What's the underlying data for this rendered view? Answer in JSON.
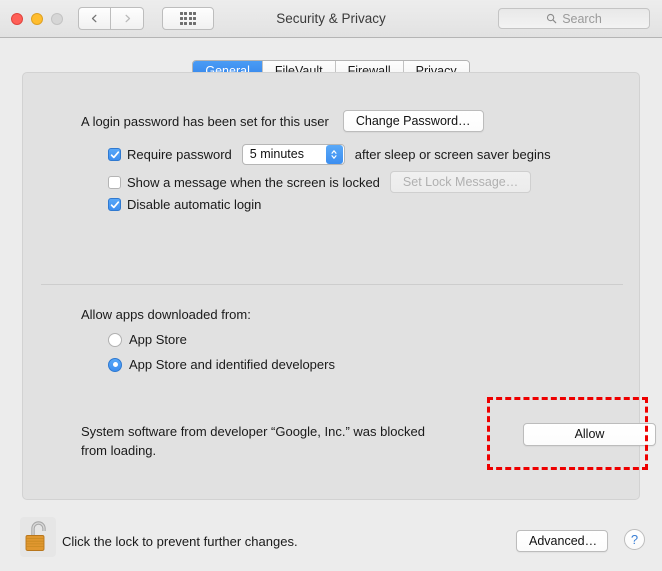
{
  "window": {
    "title": "Security & Privacy",
    "traffic": {
      "close": "close-button",
      "minimize": "minimize-button",
      "zoom": "zoom-button"
    },
    "nav": {
      "back": "back-button",
      "forward": "forward-button",
      "show_all": "show-all-button"
    }
  },
  "search": {
    "placeholder": "Search",
    "value": ""
  },
  "tabs": [
    {
      "label": "General",
      "active": true
    },
    {
      "label": "FileVault",
      "active": false
    },
    {
      "label": "Firewall",
      "active": false
    },
    {
      "label": "Privacy",
      "active": false
    }
  ],
  "general": {
    "password_status": "A login password has been set for this user",
    "change_password_label": "Change Password…",
    "require_password": {
      "label": "Require password",
      "checked": true,
      "delay_value": "5 minutes",
      "suffix": "after sleep or screen saver begins"
    },
    "lock_message": {
      "label": "Show a message when the screen is locked",
      "checked": false,
      "button_label": "Set Lock Message…",
      "button_disabled": true
    },
    "disable_auto_login": {
      "label": "Disable automatic login",
      "checked": true
    },
    "allow_apps_heading": "Allow apps downloaded from:",
    "allow_options": [
      {
        "label": "App Store",
        "selected": false
      },
      {
        "label": "App Store and identified developers",
        "selected": true
      }
    ],
    "blocked_notice": "System software from developer “Google, Inc.” was blocked from loading.",
    "allow_button_label": "Allow"
  },
  "footer": {
    "lock_text": "Click the lock to prevent further changes.",
    "advanced_label": "Advanced…",
    "help_label": "?"
  },
  "colors": {
    "accent_blue": "#3c8ef0",
    "tab_active": "#2f7fe8",
    "annotation_red": "#ee0000",
    "window_bg": "#ececec",
    "panel_bg": "#e1e1e1"
  }
}
